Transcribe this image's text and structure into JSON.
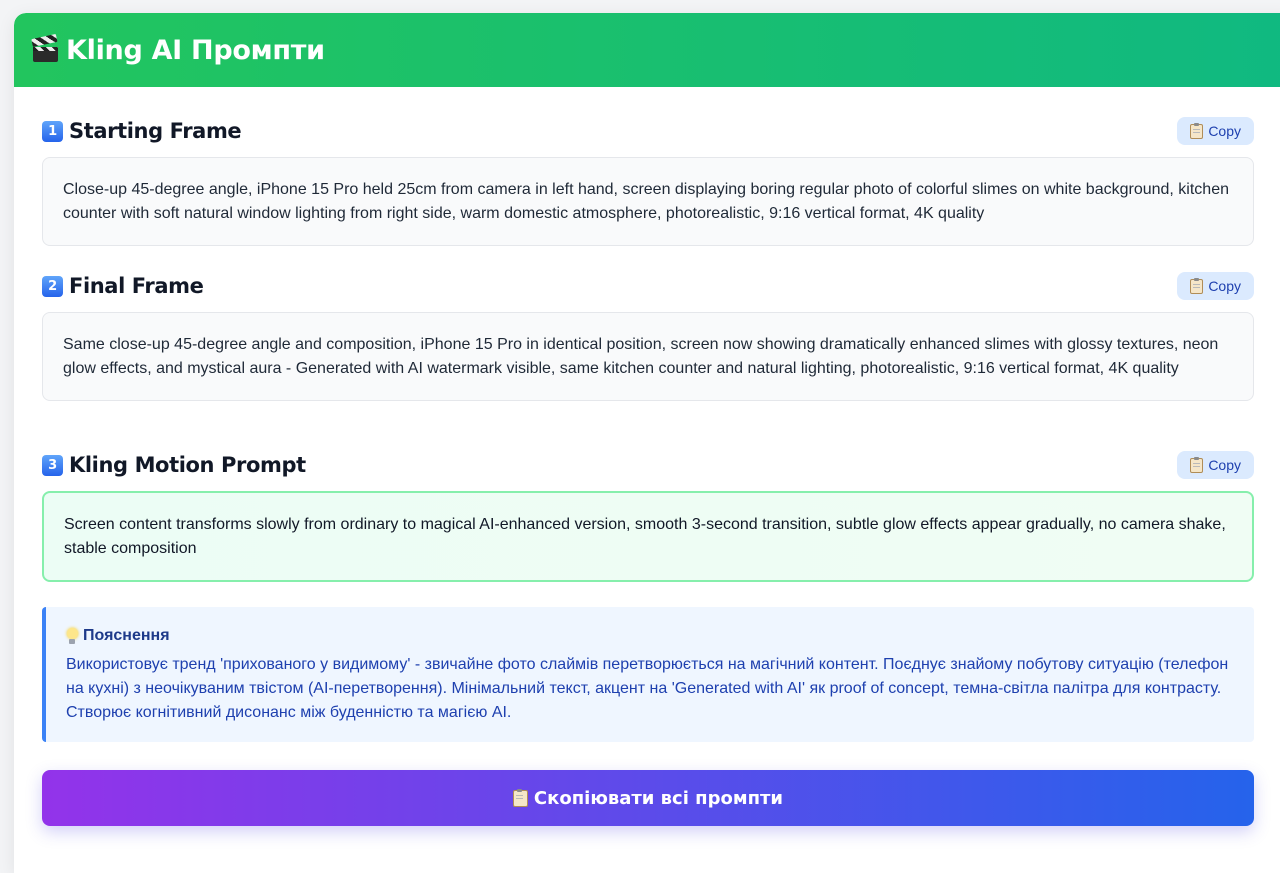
{
  "header": {
    "icon": "clapperboard-icon",
    "title": "Kling AI Промпти"
  },
  "sections": [
    {
      "number": "1",
      "title": "Starting Frame",
      "copy_label": "Copy",
      "text": "Close-up 45-degree angle, iPhone 15 Pro held 25cm from camera in left hand, screen displaying boring regular photo of colorful slimes on white background, kitchen counter with soft natural window lighting from right side, warm domestic atmosphere, photorealistic, 9:16 vertical format, 4K quality"
    },
    {
      "number": "2",
      "title": "Final Frame",
      "copy_label": "Copy",
      "text": "Same close-up 45-degree angle and composition, iPhone 15 Pro in identical position, screen now showing dramatically enhanced slimes with glossy textures, neon glow effects, and mystical aura - Generated with AI watermark visible, same kitchen counter and natural lighting, photorealistic, 9:16 vertical format, 4K quality"
    },
    {
      "number": "3",
      "title": "Kling Motion Prompt",
      "copy_label": "Copy",
      "text": "Screen content transforms slowly from ordinary to magical AI-enhanced version, smooth 3-second transition, subtle glow effects appear gradually, no camera shake, stable composition"
    }
  ],
  "explanation": {
    "icon": "lightbulb-icon",
    "title": "Пояснення",
    "text": "Використовує тренд 'прихованого у видимому' - звичайне фото слаймів перетворюється на магічний контент. Поєднує знайому побутову ситуацію (телефон на кухні) з неочікуваним твістом (AI-перетворення). Мінімальний текст, акцент на 'Generated with AI' як proof of concept, темна-світла палітра для контрасту. Створює когнітивний дисонанс між буденністю та магією AI."
  },
  "copy_all": {
    "icon": "clipboard-icon",
    "label": "Скопіювати всі промпти"
  },
  "colors": {
    "header_gradient": [
      "#22c55e",
      "#10b981"
    ],
    "copy_all_gradient": [
      "#9333ea",
      "#2563eb"
    ],
    "explain_accent": "#3b82f6",
    "motion_border": "#86efac"
  }
}
